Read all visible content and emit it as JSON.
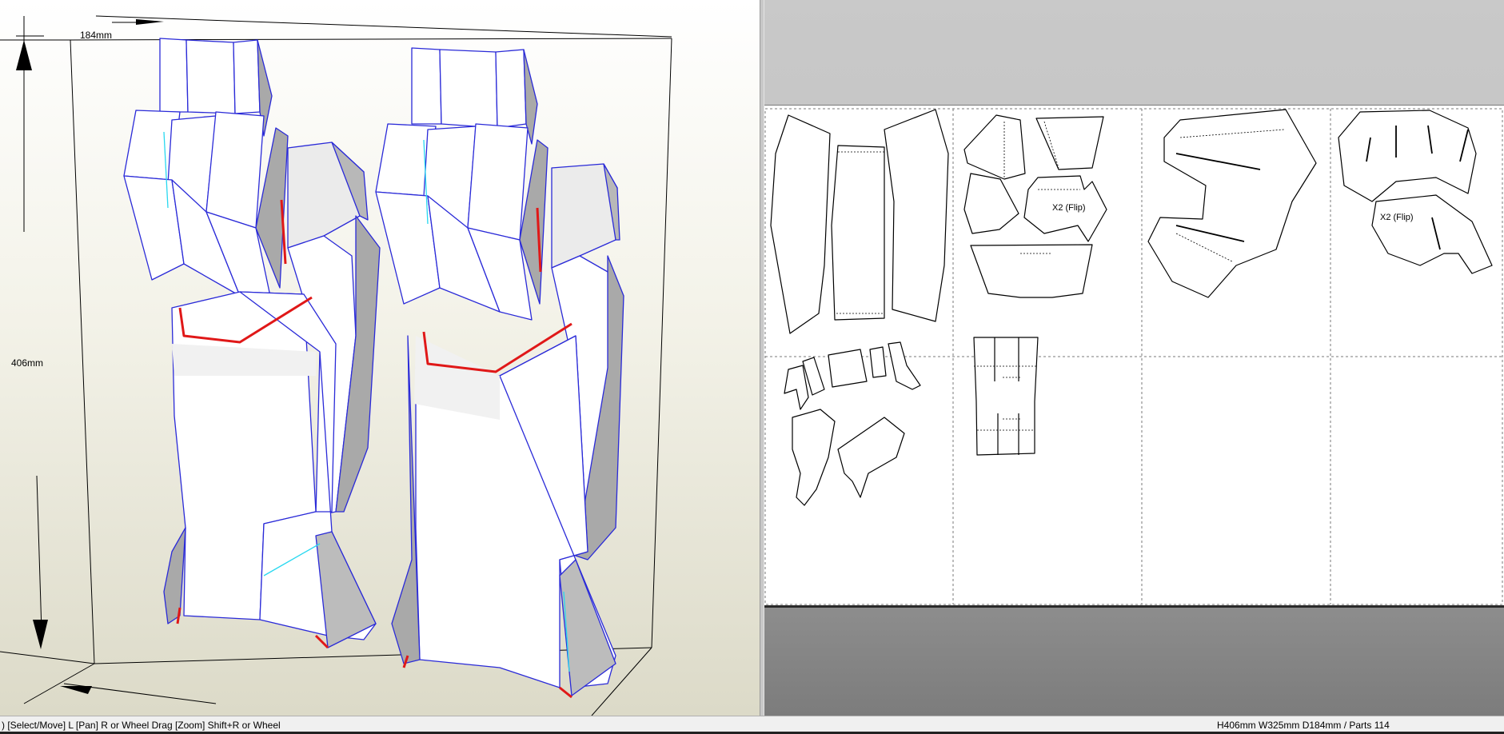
{
  "viewport3d": {
    "dimensions": {
      "depth_label": "184mm",
      "height_label": "406mm"
    }
  },
  "viewport2d": {
    "part_notes": {
      "flip_note_1": "X2 (Flip)",
      "flip_note_2": "X2 (Flip)"
    }
  },
  "statusbar": {
    "hint_text": ") [Select/Move] L [Pan] R or Wheel Drag [Zoom] Shift+R or Wheel",
    "model_info": "H406mm W325mm D184mm / Parts 114"
  },
  "colors": {
    "model_edge": "#2a2ad8",
    "fold_edge": "#e01818",
    "highlight_edge": "#28d8f0",
    "face_white": "#ffffff",
    "face_shade": "#a9a9a9"
  }
}
